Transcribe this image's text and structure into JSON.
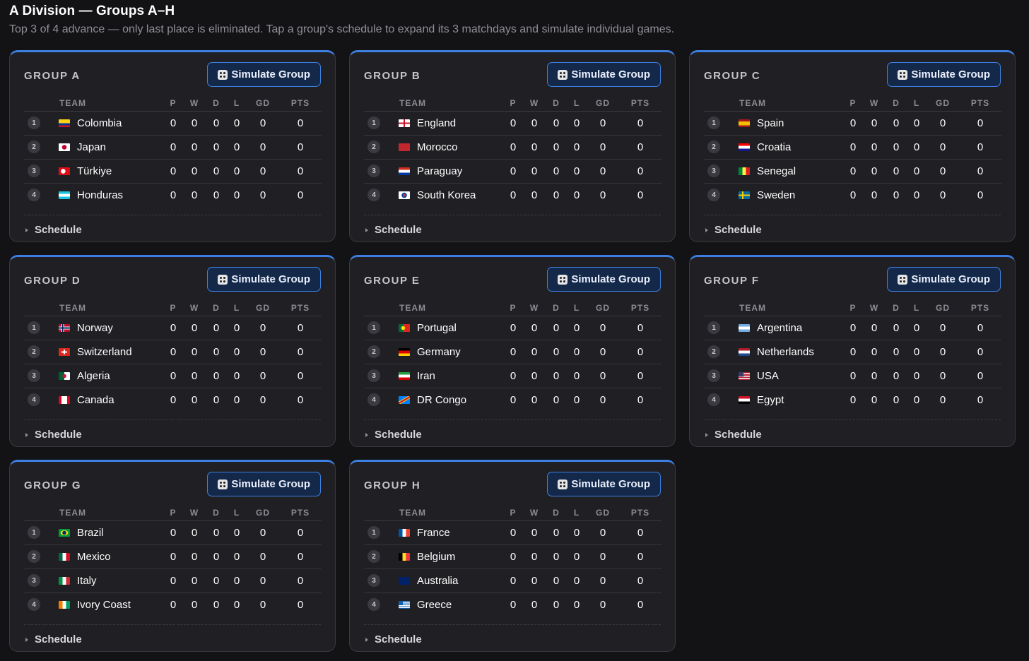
{
  "header": {
    "title": "A Division — Groups A–H",
    "subtitle": "Top 3 of 4 advance — only last place is eliminated. Tap a group's schedule to expand its 3 matchdays and simulate individual games."
  },
  "labels": {
    "simulate": "Simulate Group",
    "schedule": "Schedule",
    "columns": [
      "TEAM",
      "P",
      "W",
      "D",
      "L",
      "GD",
      "PTS"
    ]
  },
  "colors": {
    "accent": "#3d7fe0",
    "button_bg": "#14294a",
    "card_bg": "#202024",
    "page_bg": "#131316"
  },
  "groups": [
    {
      "name": "GROUP A",
      "teams": [
        {
          "rank": "1",
          "name": "Colombia",
          "flag": "colombia-flag-icon",
          "stats": [
            "0",
            "0",
            "0",
            "0",
            "0",
            "0"
          ]
        },
        {
          "rank": "2",
          "name": "Japan",
          "flag": "japan-flag-icon",
          "stats": [
            "0",
            "0",
            "0",
            "0",
            "0",
            "0"
          ]
        },
        {
          "rank": "3",
          "name": "Türkiye",
          "flag": "turkiye-flag-icon",
          "stats": [
            "0",
            "0",
            "0",
            "0",
            "0",
            "0"
          ]
        },
        {
          "rank": "4",
          "name": "Honduras",
          "flag": "honduras-flag-icon",
          "stats": [
            "0",
            "0",
            "0",
            "0",
            "0",
            "0"
          ]
        }
      ]
    },
    {
      "name": "GROUP B",
      "teams": [
        {
          "rank": "1",
          "name": "England",
          "flag": "england-flag-icon",
          "stats": [
            "0",
            "0",
            "0",
            "0",
            "0",
            "0"
          ]
        },
        {
          "rank": "2",
          "name": "Morocco",
          "flag": "morocco-flag-icon",
          "stats": [
            "0",
            "0",
            "0",
            "0",
            "0",
            "0"
          ]
        },
        {
          "rank": "3",
          "name": "Paraguay",
          "flag": "paraguay-flag-icon",
          "stats": [
            "0",
            "0",
            "0",
            "0",
            "0",
            "0"
          ]
        },
        {
          "rank": "4",
          "name": "South Korea",
          "flag": "south-korea-flag-icon",
          "stats": [
            "0",
            "0",
            "0",
            "0",
            "0",
            "0"
          ]
        }
      ]
    },
    {
      "name": "GROUP C",
      "teams": [
        {
          "rank": "1",
          "name": "Spain",
          "flag": "spain-flag-icon",
          "stats": [
            "0",
            "0",
            "0",
            "0",
            "0",
            "0"
          ]
        },
        {
          "rank": "2",
          "name": "Croatia",
          "flag": "croatia-flag-icon",
          "stats": [
            "0",
            "0",
            "0",
            "0",
            "0",
            "0"
          ]
        },
        {
          "rank": "3",
          "name": "Senegal",
          "flag": "senegal-flag-icon",
          "stats": [
            "0",
            "0",
            "0",
            "0",
            "0",
            "0"
          ]
        },
        {
          "rank": "4",
          "name": "Sweden",
          "flag": "sweden-flag-icon",
          "stats": [
            "0",
            "0",
            "0",
            "0",
            "0",
            "0"
          ]
        }
      ]
    },
    {
      "name": "GROUP D",
      "teams": [
        {
          "rank": "1",
          "name": "Norway",
          "flag": "norway-flag-icon",
          "stats": [
            "0",
            "0",
            "0",
            "0",
            "0",
            "0"
          ]
        },
        {
          "rank": "2",
          "name": "Switzerland",
          "flag": "switzerland-flag-icon",
          "stats": [
            "0",
            "0",
            "0",
            "0",
            "0",
            "0"
          ]
        },
        {
          "rank": "3",
          "name": "Algeria",
          "flag": "algeria-flag-icon",
          "stats": [
            "0",
            "0",
            "0",
            "0",
            "0",
            "0"
          ]
        },
        {
          "rank": "4",
          "name": "Canada",
          "flag": "canada-flag-icon",
          "stats": [
            "0",
            "0",
            "0",
            "0",
            "0",
            "0"
          ]
        }
      ]
    },
    {
      "name": "GROUP E",
      "teams": [
        {
          "rank": "1",
          "name": "Portugal",
          "flag": "portugal-flag-icon",
          "stats": [
            "0",
            "0",
            "0",
            "0",
            "0",
            "0"
          ]
        },
        {
          "rank": "2",
          "name": "Germany",
          "flag": "germany-flag-icon",
          "stats": [
            "0",
            "0",
            "0",
            "0",
            "0",
            "0"
          ]
        },
        {
          "rank": "3",
          "name": "Iran",
          "flag": "iran-flag-icon",
          "stats": [
            "0",
            "0",
            "0",
            "0",
            "0",
            "0"
          ]
        },
        {
          "rank": "4",
          "name": "DR Congo",
          "flag": "dr-congo-flag-icon",
          "stats": [
            "0",
            "0",
            "0",
            "0",
            "0",
            "0"
          ]
        }
      ]
    },
    {
      "name": "GROUP F",
      "teams": [
        {
          "rank": "1",
          "name": "Argentina",
          "flag": "argentina-flag-icon",
          "stats": [
            "0",
            "0",
            "0",
            "0",
            "0",
            "0"
          ]
        },
        {
          "rank": "2",
          "name": "Netherlands",
          "flag": "netherlands-flag-icon",
          "stats": [
            "0",
            "0",
            "0",
            "0",
            "0",
            "0"
          ]
        },
        {
          "rank": "3",
          "name": "USA",
          "flag": "usa-flag-icon",
          "stats": [
            "0",
            "0",
            "0",
            "0",
            "0",
            "0"
          ]
        },
        {
          "rank": "4",
          "name": "Egypt",
          "flag": "egypt-flag-icon",
          "stats": [
            "0",
            "0",
            "0",
            "0",
            "0",
            "0"
          ]
        }
      ]
    },
    {
      "name": "GROUP G",
      "teams": [
        {
          "rank": "1",
          "name": "Brazil",
          "flag": "brazil-flag-icon",
          "stats": [
            "0",
            "0",
            "0",
            "0",
            "0",
            "0"
          ]
        },
        {
          "rank": "2",
          "name": "Mexico",
          "flag": "mexico-flag-icon",
          "stats": [
            "0",
            "0",
            "0",
            "0",
            "0",
            "0"
          ]
        },
        {
          "rank": "3",
          "name": "Italy",
          "flag": "italy-flag-icon",
          "stats": [
            "0",
            "0",
            "0",
            "0",
            "0",
            "0"
          ]
        },
        {
          "rank": "4",
          "name": "Ivory Coast",
          "flag": "ivory-coast-flag-icon",
          "stats": [
            "0",
            "0",
            "0",
            "0",
            "0",
            "0"
          ]
        }
      ]
    },
    {
      "name": "GROUP H",
      "teams": [
        {
          "rank": "1",
          "name": "France",
          "flag": "france-flag-icon",
          "stats": [
            "0",
            "0",
            "0",
            "0",
            "0",
            "0"
          ]
        },
        {
          "rank": "2",
          "name": "Belgium",
          "flag": "belgium-flag-icon",
          "stats": [
            "0",
            "0",
            "0",
            "0",
            "0",
            "0"
          ]
        },
        {
          "rank": "3",
          "name": "Australia",
          "flag": "australia-flag-icon",
          "stats": [
            "0",
            "0",
            "0",
            "0",
            "0",
            "0"
          ]
        },
        {
          "rank": "4",
          "name": "Greece",
          "flag": "greece-flag-icon",
          "stats": [
            "0",
            "0",
            "0",
            "0",
            "0",
            "0"
          ]
        }
      ]
    }
  ]
}
